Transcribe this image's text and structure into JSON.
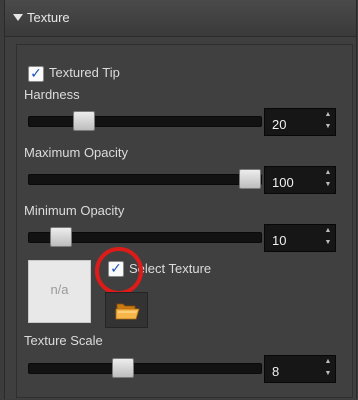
{
  "header": {
    "title": "Texture"
  },
  "textured_tip": {
    "label": "Textured Tip",
    "checked": true
  },
  "hardness": {
    "label": "Hardness",
    "value": "20",
    "slider_level": 0.2
  },
  "max_opacity": {
    "label": "Maximum Opacity",
    "value": "100",
    "slider_level": 1.0
  },
  "min_opacity": {
    "label": "Minimum Opacity",
    "value": "10",
    "slider_level": 0.1
  },
  "texture": {
    "preview_text": "n/a",
    "select_label": "Select Texture",
    "select_checked": true
  },
  "texture_scale": {
    "label": "Texture Scale",
    "value": "8",
    "slider_level": 0.4
  },
  "icons": {
    "collapse": "triangle-down-icon",
    "folder": "folder-open-icon",
    "spin_up": "arrow-up-icon",
    "spin_down": "arrow-down-icon"
  },
  "colors": {
    "highlight_ring": "#dd1c1a",
    "checkmark": "#1a53b7",
    "background": "#3f3f3f"
  }
}
